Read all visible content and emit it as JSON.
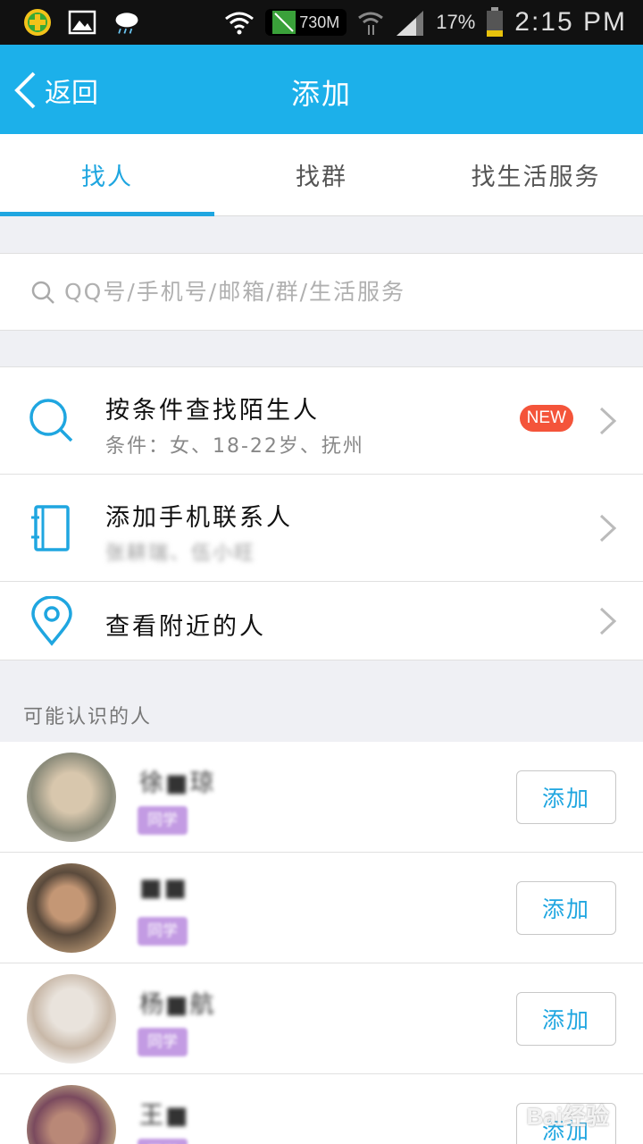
{
  "status_bar": {
    "speed": "730M",
    "battery_percent": "17%",
    "time": "2:15 PM"
  },
  "header": {
    "back_label": "返回",
    "title": "添加"
  },
  "tabs": [
    {
      "label": "找人",
      "active": true
    },
    {
      "label": "找群",
      "active": false
    },
    {
      "label": "找生活服务",
      "active": false
    }
  ],
  "search": {
    "placeholder": "QQ号/手机号/邮箱/群/生活服务"
  },
  "options": [
    {
      "icon": "search-icon",
      "title": "按条件查找陌生人",
      "subtitle": "条件：女、18-22岁、抚州",
      "badge": "NEW"
    },
    {
      "icon": "contacts-book-icon",
      "title": "添加手机联系人",
      "subtitle": "张耕瑞、伍小旺"
    },
    {
      "icon": "location-pin-icon",
      "title": "查看附近的人"
    }
  ],
  "may_know": {
    "label": "可能认识的人",
    "add_label": "添加",
    "people": [
      {
        "name": "徐■琼",
        "tag": "同学"
      },
      {
        "name": "■■",
        "tag": "同学"
      },
      {
        "name": "杨■航",
        "tag": "同学"
      },
      {
        "name": "王■",
        "tag": "同学"
      }
    ]
  },
  "watermark": "Bai经验",
  "colors": {
    "brand_blue": "#1cb0ea",
    "accent_blue": "#1fa6e0",
    "badge_red": "#f4543a",
    "tag_purple": "#c39be3"
  }
}
